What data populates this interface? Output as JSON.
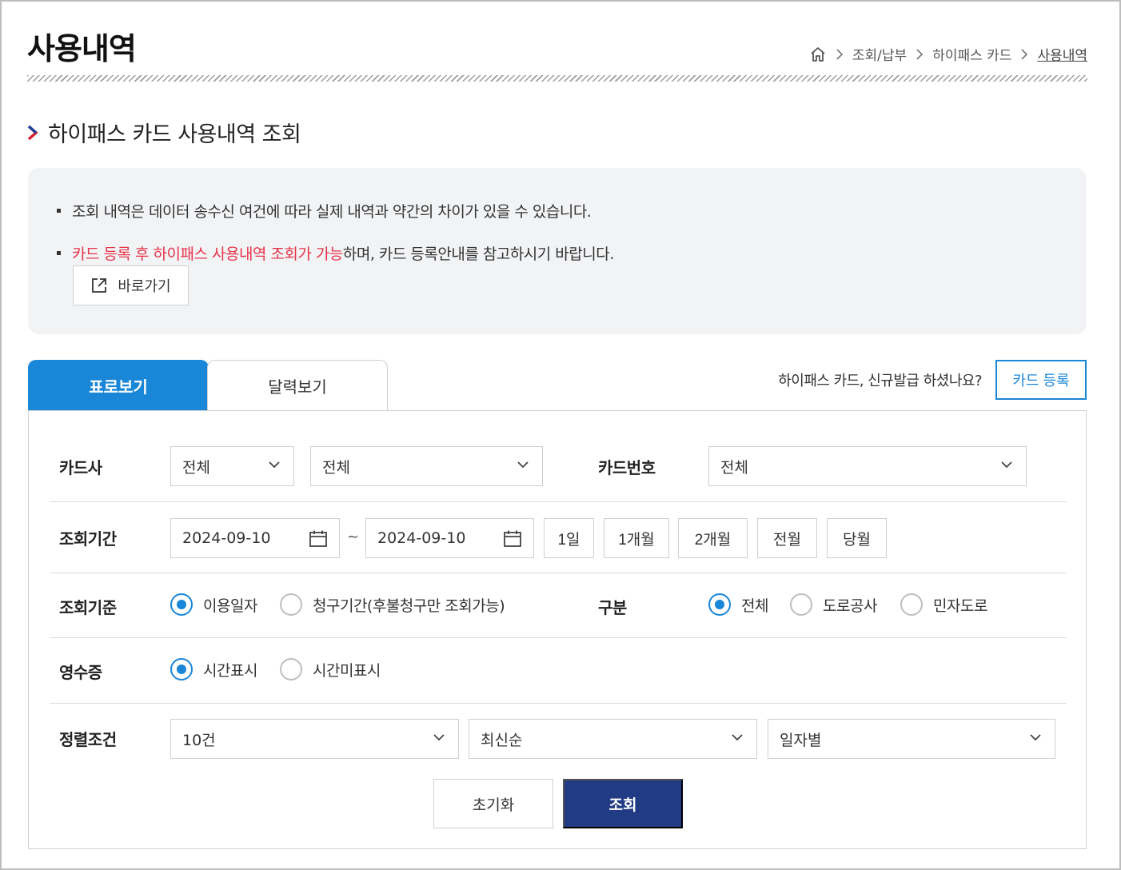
{
  "header": {
    "title": "사용내역",
    "breadcrumb": [
      "조회/납부",
      "하이패스 카드",
      "사용내역"
    ]
  },
  "section": {
    "title": "하이패스 카드 사용내역 조회"
  },
  "notice": {
    "line1": "조회 내역은 데이터 송수신 여건에 따라 실제 내역과 약간의 차이가 있을 수 있습니다.",
    "line2_highlight": "카드 등록 후 하이패스 사용내역 조회가 가능",
    "line2_rest": "하며, 카드 등록안내를 참고하시기 바랍니다.",
    "goto_label": "바로가기"
  },
  "tabs": [
    {
      "label": "표로보기",
      "active": true
    },
    {
      "label": "달력보기",
      "active": false
    }
  ],
  "registration": {
    "question": "하이패스 카드, 신규발급 하셨나요?",
    "button": "카드 등록"
  },
  "form": {
    "card_company": {
      "label": "카드사",
      "select1": "전체",
      "select2": "전체"
    },
    "card_number": {
      "label": "카드번호",
      "value": "전체"
    },
    "period": {
      "label": "조회기간",
      "start": "2024-09-10",
      "separator": "~",
      "end": "2024-09-10",
      "quick": [
        "1일",
        "1개월",
        "2개월",
        "전월",
        "당월"
      ]
    },
    "criteria": {
      "label": "조회기준",
      "options": [
        {
          "label": "이용일자",
          "checked": true
        },
        {
          "label": "청구기간(후불청구만 조회가능)",
          "checked": false
        }
      ]
    },
    "division": {
      "label": "구분",
      "options": [
        {
          "label": "전체",
          "checked": true
        },
        {
          "label": "도로공사",
          "checked": false
        },
        {
          "label": "민자도로",
          "checked": false
        }
      ]
    },
    "receipt": {
      "label": "영수증",
      "options": [
        {
          "label": "시간표시",
          "checked": true
        },
        {
          "label": "시간미표시",
          "checked": false
        }
      ]
    },
    "sort": {
      "label": "정렬조건",
      "count": "10건",
      "order": "최신순",
      "group": "일자별"
    }
  },
  "actions": {
    "reset": "초기화",
    "search": "조회"
  },
  "colors": {
    "primary_blue": "#1a86d8",
    "navy": "#213b84",
    "highlight_red": "#e8334a",
    "info_bg": "#f2f3f5"
  }
}
